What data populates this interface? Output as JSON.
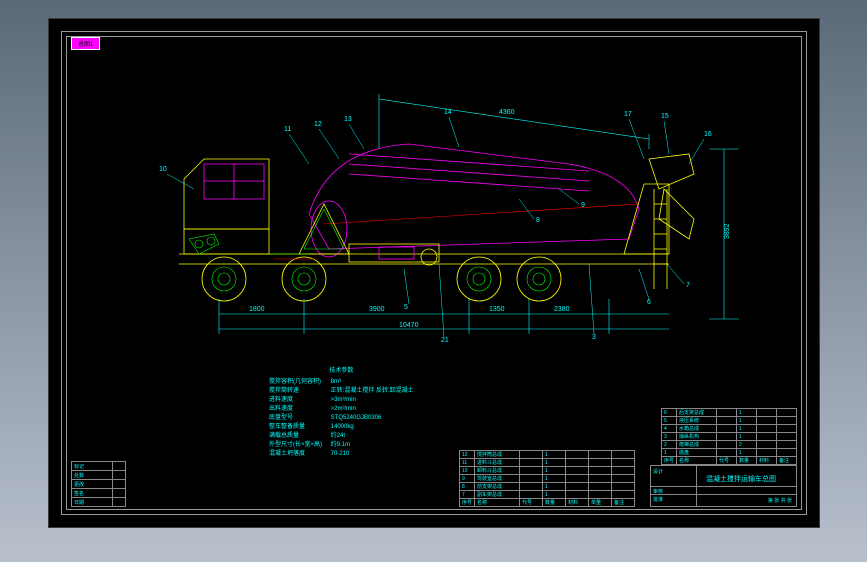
{
  "tag": "总图1",
  "dimensions": {
    "drum_length": "4360",
    "overall_length": "10470",
    "front_axle_spacing_1": "1800",
    "mid_axle_spacing": "3900",
    "rear_axle_spacing_1": "1350",
    "rear_axle_spacing_2": "2380",
    "overall_height": "3892",
    "callouts": [
      "10",
      "11",
      "12",
      "13",
      "14",
      "17",
      "15",
      "16",
      "9",
      "8",
      "7",
      "6",
      "5",
      "21",
      "3"
    ]
  },
  "specs": {
    "title": "技术参数",
    "rows": [
      {
        "k": "搅拌容积(几何容积)",
        "v": "8m³"
      },
      {
        "k": "搅拌筒转速",
        "v": "正转:混凝土搅拌 反转:卸混凝土"
      },
      {
        "k": "进料速度",
        "v": ">3m³/min"
      },
      {
        "k": "出料速度",
        "v": ">2m³/min"
      },
      {
        "k": "底盘型号",
        "v": "STQ5240GJB0306"
      },
      {
        "k": "整车整备质量",
        "v": "14000kg"
      },
      {
        "k": "满载总质量",
        "v": "约24t"
      },
      {
        "k": "外型尺寸(长×宽×高)",
        "v": "约9.1m"
      },
      {
        "k": "混凝土坍落度",
        "v": "70-210"
      }
    ]
  },
  "bom_left": [
    {
      "n": "12",
      "name": "搅拌筒总成",
      "code": "",
      "qty": "1",
      "mat": "",
      "wt": "",
      "note": ""
    },
    {
      "n": "11",
      "name": "进料斗总成",
      "code": "",
      "qty": "1",
      "mat": "",
      "wt": "",
      "note": ""
    },
    {
      "n": "10",
      "name": "卸料斗总成",
      "code": "",
      "qty": "1",
      "mat": "",
      "wt": "",
      "note": ""
    },
    {
      "n": "9",
      "name": "驾驶室总成",
      "code": "",
      "qty": "1",
      "mat": "",
      "wt": "",
      "note": ""
    },
    {
      "n": "8",
      "name": "前支架总成",
      "code": "",
      "qty": "1",
      "mat": "",
      "wt": "",
      "note": ""
    },
    {
      "n": "7",
      "name": "副车架总成",
      "code": "",
      "qty": "1",
      "mat": "",
      "wt": "",
      "note": ""
    },
    {
      "n": "序号",
      "name": "名称",
      "code": "代号",
      "qty": "数量",
      "mat": "材料",
      "wt": "单重",
      "note": "备注"
    }
  ],
  "bom_right": [
    {
      "n": "6",
      "name": "后支架总成",
      "code": "",
      "qty": "1",
      "mat": "",
      "note": ""
    },
    {
      "n": "5",
      "name": "液压系统",
      "code": "",
      "qty": "1",
      "mat": "",
      "note": ""
    },
    {
      "n": "4",
      "name": "水箱总成",
      "code": "",
      "qty": "1",
      "mat": "",
      "note": ""
    },
    {
      "n": "3",
      "name": "操纵机构",
      "code": "",
      "qty": "1",
      "mat": "",
      "note": ""
    },
    {
      "n": "2",
      "name": "爬梯总成",
      "code": "",
      "qty": "2",
      "mat": "",
      "note": ""
    },
    {
      "n": "1",
      "name": "底盘",
      "code": "",
      "qty": "1",
      "mat": "",
      "note": ""
    },
    {
      "n": "序号",
      "name": "名称",
      "code": "代号",
      "qty": "数量",
      "mat": "材料",
      "note": "备注"
    }
  ],
  "title_block": {
    "drawing_name": "混凝土搅拌运输车总图",
    "model": "设计",
    "scale_label": "比例",
    "sheet_label": "第 张 共 张",
    "designer_row": "设计",
    "check_row": "审核",
    "approve_row": "批准"
  },
  "left_table": {
    "rows": [
      "标记",
      "处数",
      "更改",
      "签名",
      "日期"
    ]
  }
}
